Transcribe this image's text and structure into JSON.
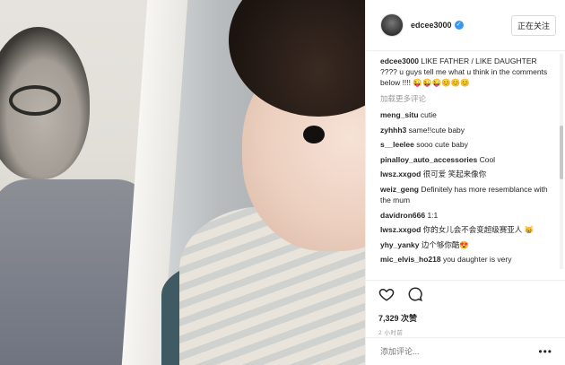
{
  "post": {
    "username": "edcee3000",
    "verified_mark": "✓",
    "follow_label": "正在关注",
    "caption_user": "edcee3000",
    "caption_text": "LIKE FATHER / LIKE DAUGHTER ???? u guys tell me what u think in the comments below !!!! 😜😜😜😊😊😊",
    "load_more": "加载更多评论",
    "comments": [
      {
        "user": "meng_situ",
        "text": "cutie"
      },
      {
        "user": "zyhhh3",
        "text": "same!!cute baby"
      },
      {
        "user": "s__leelee",
        "text": "sooo cute baby"
      },
      {
        "user": "pinalloy_auto_accessories",
        "text": "Cool"
      },
      {
        "user": "lwsz.xxgod",
        "text": "很可爱 笑起来像你"
      },
      {
        "user": "weiz_geng",
        "text": "Definitely has more resemblance with the mum"
      },
      {
        "user": "davidron666",
        "text": "1:1"
      },
      {
        "user": "lwsz.xxgod",
        "text": "你的女儿会不会变超级赛亚人 😸"
      },
      {
        "user": "yhy_yanky",
        "text": "边个够你酷😍"
      },
      {
        "user": "mic_elvis_ho218",
        "text": "you daughter is very"
      }
    ],
    "likes": "7,329 次赞",
    "time": "2 小时前",
    "add_comment_placeholder": "添加评论...",
    "more_label": "•••"
  },
  "icons": {
    "avatar": "avatar",
    "heart": "heart-icon",
    "comment": "comment-icon",
    "verified": "verified-icon"
  },
  "colors": {
    "accent": "#3897f0",
    "text": "#262626",
    "muted": "#999999",
    "border": "#efefef"
  }
}
